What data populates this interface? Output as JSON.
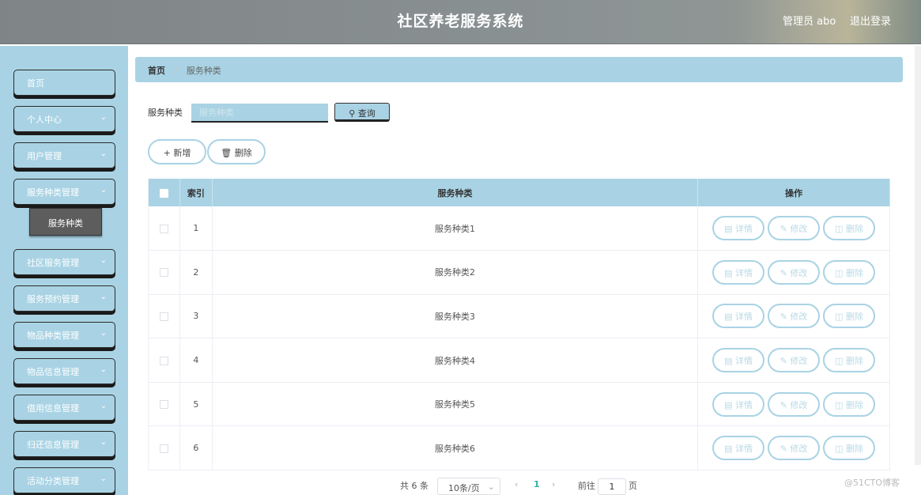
{
  "header": {
    "title": "社区养老服务系统",
    "user": "管理员 abo",
    "logout": "退出登录"
  },
  "sidebar": {
    "items": [
      {
        "label": "首页",
        "has_chevron": false
      },
      {
        "label": "个人中心",
        "has_chevron": true
      },
      {
        "label": "用户管理",
        "has_chevron": true
      },
      {
        "label": "服务种类管理",
        "has_chevron": true
      },
      {
        "label": "社区服务管理",
        "has_chevron": true
      },
      {
        "label": "服务预约管理",
        "has_chevron": true
      },
      {
        "label": "物品种类管理",
        "has_chevron": true
      },
      {
        "label": "物品信息管理",
        "has_chevron": true
      },
      {
        "label": "借用信息管理",
        "has_chevron": true
      },
      {
        "label": "归还信息管理",
        "has_chevron": true
      },
      {
        "label": "活动分类管理",
        "has_chevron": true
      }
    ],
    "submenu": {
      "label": "服务种类"
    }
  },
  "breadcrumb": {
    "home": "首页",
    "separator": "/",
    "current": "服务种类"
  },
  "search": {
    "label": "服务种类",
    "placeholder": "服务种类",
    "value": "",
    "button": "查询"
  },
  "actions": {
    "add": "新增",
    "delete": "删除"
  },
  "table": {
    "headers": {
      "index": "索引",
      "category": "服务种类",
      "ops": "操作"
    },
    "rows": [
      {
        "index": "1",
        "category": "服务种类1"
      },
      {
        "index": "2",
        "category": "服务种类2"
      },
      {
        "index": "3",
        "category": "服务种类3"
      },
      {
        "index": "4",
        "category": "服务种类4"
      },
      {
        "index": "5",
        "category": "服务种类5"
      },
      {
        "index": "6",
        "category": "服务种类6"
      }
    ],
    "row_actions": {
      "detail": "详情",
      "edit": "修改",
      "delete": "删除"
    }
  },
  "pagination": {
    "total": "共 6 条",
    "page_size": "10条/页",
    "current_page": "1",
    "goto_label": "前往",
    "goto_value": "1",
    "page_unit": "页"
  },
  "watermark": "@51CTO博客",
  "colors": {
    "accent": "#a9d3e4",
    "header": "#888f91",
    "submenu_active": "#5d5d5d"
  }
}
